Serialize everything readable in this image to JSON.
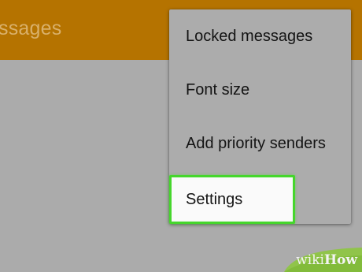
{
  "app_bar": {
    "title": "ssages",
    "color": "#b57300"
  },
  "menu": {
    "items": [
      {
        "label": "Locked messages"
      },
      {
        "label": "Font size"
      },
      {
        "label": "Add priority senders"
      },
      {
        "label": "Settings",
        "highlighted": true
      }
    ],
    "highlight_color": "#45d62c"
  },
  "watermark": {
    "wiki": "wiki",
    "how": "How"
  }
}
